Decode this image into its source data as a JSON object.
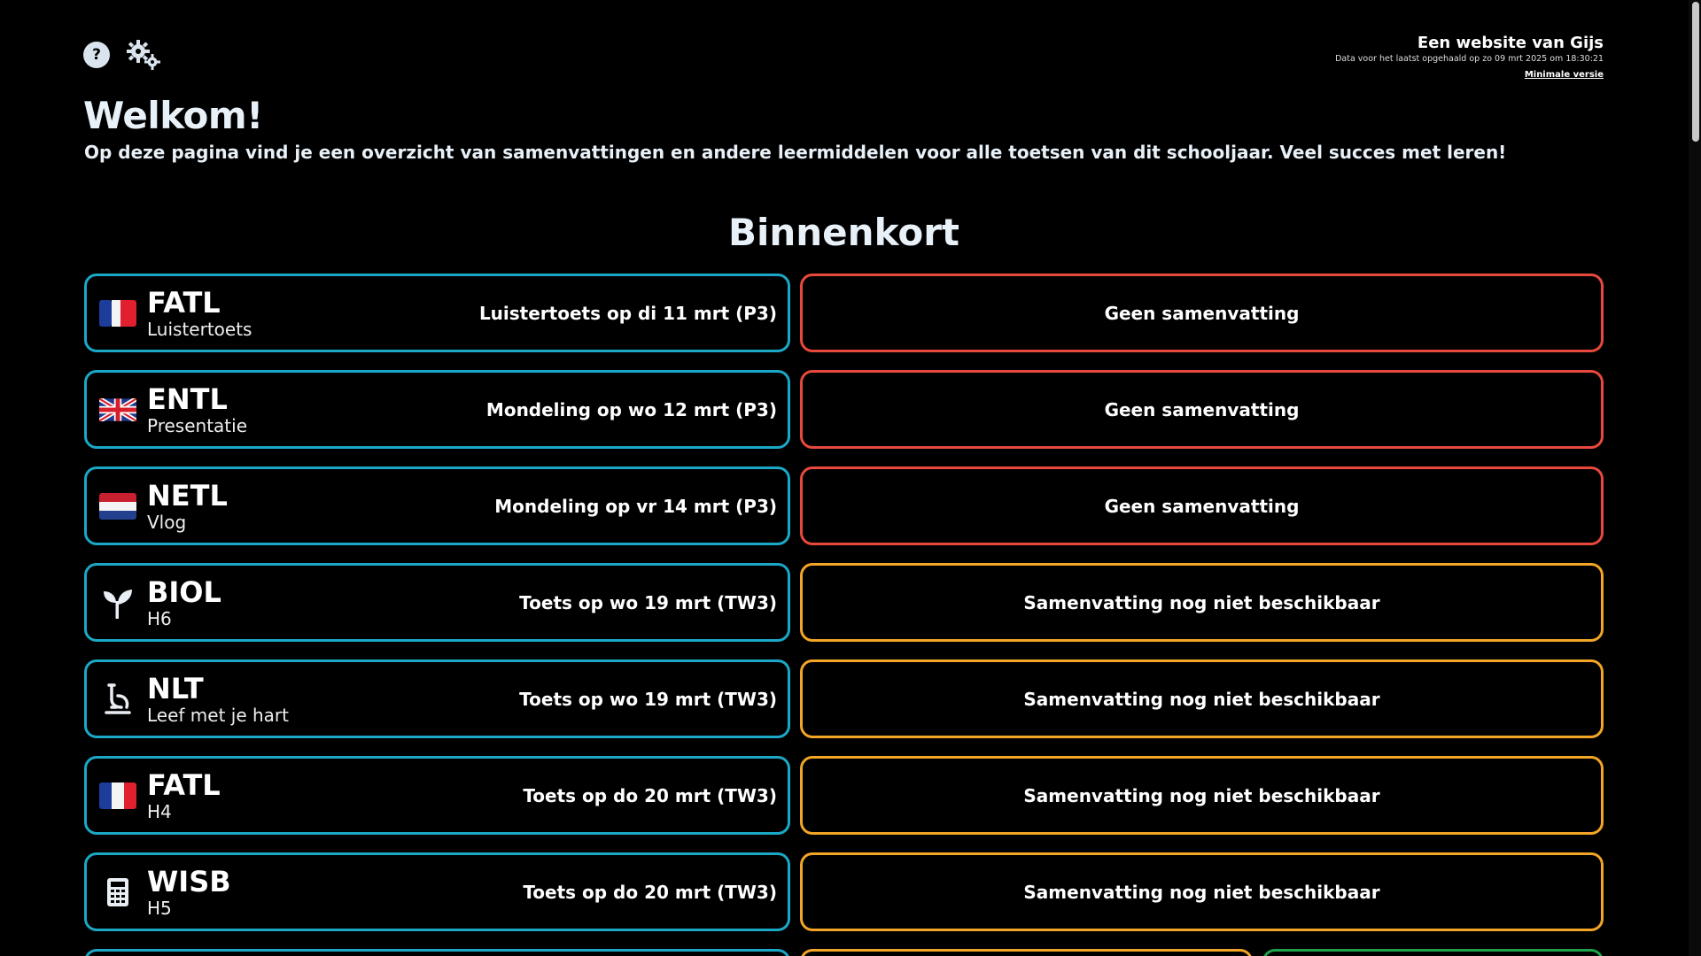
{
  "header": {
    "credit_prefix": "Een website van",
    "credit_name": "Gijs",
    "data_note": "Data voor het laatst opgehaald op zo 09 mrt 2025 om 18:30:21",
    "minimal_link": "Minimale versie"
  },
  "welcome": {
    "title": "Welkom!",
    "intro": "Op deze pagina vind je een overzicht van samenvattingen en andere leermiddelen voor alle toetsen van dit schooljaar. Veel succes met leren!"
  },
  "section": {
    "title": "Binnenkort"
  },
  "rows": [
    {
      "icon": "france-flag-icon",
      "code": "FATL",
      "topic": "Luistertoets",
      "date": "Luistertoets op di 11 mrt (P3)",
      "summary": "Geen samenvatting"
    },
    {
      "icon": "uk-flag-icon",
      "code": "ENTL",
      "topic": "Presentatie",
      "date": "Mondeling op wo 12 mrt (P3)",
      "summary": "Geen samenvatting"
    },
    {
      "icon": "netherlands-flag-icon",
      "code": "NETL",
      "topic": "Vlog",
      "date": "Mondeling op vr 14 mrt (P3)",
      "summary": "Geen samenvatting"
    },
    {
      "icon": "sprout-icon",
      "code": "BIOL",
      "topic": "H6",
      "date": "Toets op wo 19 mrt (TW3)",
      "summary": "Samenvatting nog niet beschikbaar"
    },
    {
      "icon": "microscope-icon",
      "code": "NLT",
      "topic": "Leef met je hart",
      "date": "Toets op wo 19 mrt (TW3)",
      "summary": "Samenvatting nog niet beschikbaar"
    },
    {
      "icon": "france-flag-icon",
      "code": "FATL",
      "topic": "H4",
      "date": "Toets op do 20 mrt (TW3)",
      "summary": "Samenvatting nog niet beschikbaar"
    },
    {
      "icon": "calculator-icon",
      "code": "WISB",
      "topic": "H5",
      "date": "Toets op do 20 mrt (TW3)",
      "summary": "Samenvatting nog niet beschikbaar"
    }
  ],
  "colors": {
    "subject_border": "#1ba8c6",
    "no_summary_border": "#e8493c",
    "pending_border": "#f3a526",
    "available_border": "#1fa34a"
  }
}
